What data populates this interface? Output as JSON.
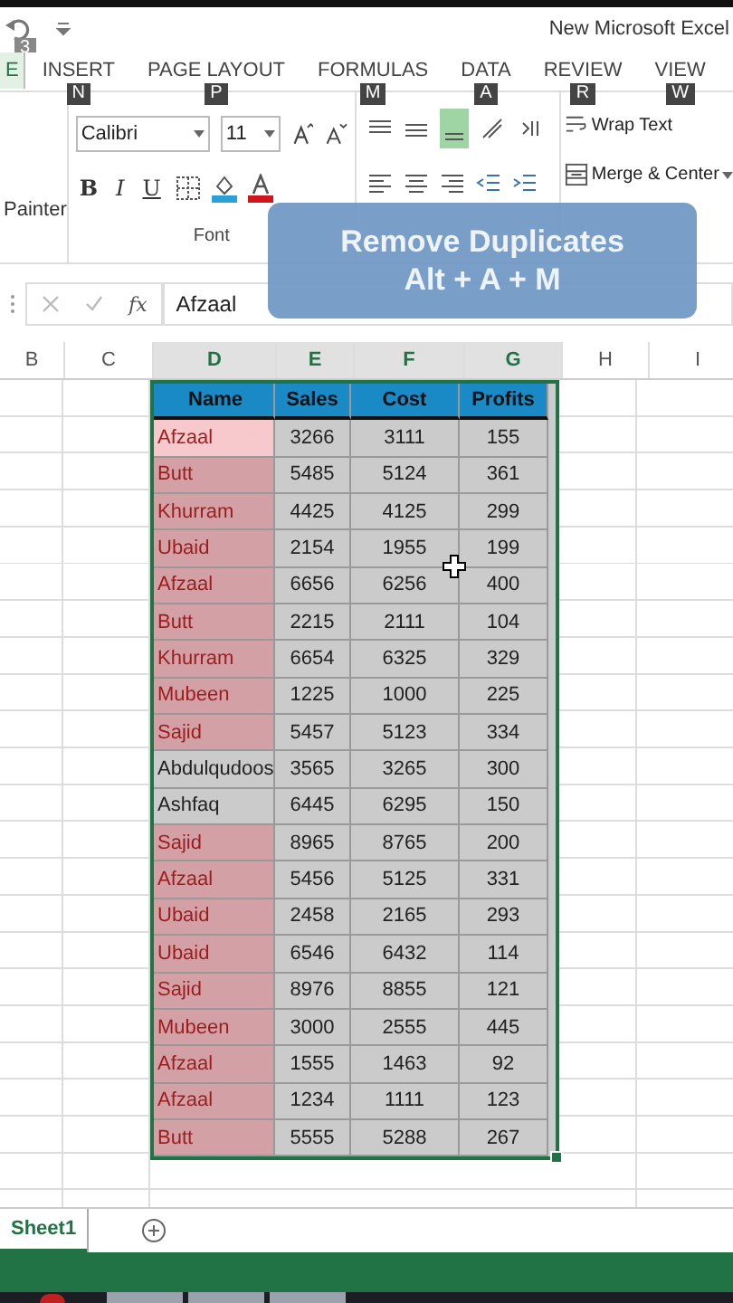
{
  "title_bar": {
    "quick_access_keytip": "3",
    "title": "New Microsoft Excel"
  },
  "tabs": [
    {
      "label": "E",
      "selected": true
    },
    {
      "label": "INSERT",
      "selected": false,
      "keytip": "N"
    },
    {
      "label": "PAGE LAYOUT",
      "selected": false,
      "keytip": "P"
    },
    {
      "label": "FORMULAS",
      "selected": false,
      "keytip": "M"
    },
    {
      "label": "DATA",
      "selected": false,
      "keytip": "A"
    },
    {
      "label": "REVIEW",
      "selected": false,
      "keytip": "R"
    },
    {
      "label": "VIEW",
      "selected": false,
      "keytip": "W"
    }
  ],
  "ribbon": {
    "painter_label": "Painter",
    "font_name": "Calibri",
    "font_size": "11",
    "bold": "B",
    "italic": "I",
    "underline": "U",
    "font_group_label": "Font",
    "wrap_text": "Wrap Text",
    "merge_center": "Merge & Center"
  },
  "overlay": {
    "title": "Remove Duplicates",
    "shortcut": "Alt + A + M"
  },
  "formula_bar": {
    "function_label": "fx",
    "value": "Afzaal"
  },
  "column_headers": [
    {
      "label": "B",
      "selected": false
    },
    {
      "label": "C",
      "selected": false
    },
    {
      "label": "D",
      "selected": true
    },
    {
      "label": "E",
      "selected": true
    },
    {
      "label": "F",
      "selected": true
    },
    {
      "label": "G",
      "selected": true
    },
    {
      "label": "H",
      "selected": false
    },
    {
      "label": "I",
      "selected": false
    }
  ],
  "table": {
    "columns": [
      "Name",
      "Sales",
      "Cost",
      "Profits"
    ],
    "rows": [
      {
        "name": "Afzaal",
        "sales": "3266",
        "cost": "3111",
        "profits": "155",
        "duplicate": true,
        "active": true
      },
      {
        "name": "Butt",
        "sales": "5485",
        "cost": "5124",
        "profits": "361",
        "duplicate": true,
        "active": false
      },
      {
        "name": "Khurram",
        "sales": "4425",
        "cost": "4125",
        "profits": "299",
        "duplicate": true,
        "active": false
      },
      {
        "name": "Ubaid",
        "sales": "2154",
        "cost": "1955",
        "profits": "199",
        "duplicate": true,
        "active": false
      },
      {
        "name": "Afzaal",
        "sales": "6656",
        "cost": "6256",
        "profits": "400",
        "duplicate": true,
        "active": false
      },
      {
        "name": "Butt",
        "sales": "2215",
        "cost": "2111",
        "profits": "104",
        "duplicate": true,
        "active": false
      },
      {
        "name": "Khurram",
        "sales": "6654",
        "cost": "6325",
        "profits": "329",
        "duplicate": true,
        "active": false
      },
      {
        "name": "Mubeen",
        "sales": "1225",
        "cost": "1000",
        "profits": "225",
        "duplicate": true,
        "active": false
      },
      {
        "name": "Sajid",
        "sales": "5457",
        "cost": "5123",
        "profits": "334",
        "duplicate": true,
        "active": false
      },
      {
        "name": "Abdulqudoos",
        "sales": "3565",
        "cost": "3265",
        "profits": "300",
        "duplicate": false,
        "active": false
      },
      {
        "name": "Ashfaq",
        "sales": "6445",
        "cost": "6295",
        "profits": "150",
        "duplicate": false,
        "active": false
      },
      {
        "name": "Sajid",
        "sales": "8965",
        "cost": "8765",
        "profits": "200",
        "duplicate": true,
        "active": false
      },
      {
        "name": "Afzaal",
        "sales": "5456",
        "cost": "5125",
        "profits": "331",
        "duplicate": true,
        "active": false
      },
      {
        "name": "Ubaid",
        "sales": "2458",
        "cost": "2165",
        "profits": "293",
        "duplicate": true,
        "active": false
      },
      {
        "name": "Ubaid",
        "sales": "6546",
        "cost": "6432",
        "profits": "114",
        "duplicate": true,
        "active": false
      },
      {
        "name": "Sajid",
        "sales": "8976",
        "cost": "8855",
        "profits": "121",
        "duplicate": true,
        "active": false
      },
      {
        "name": "Mubeen",
        "sales": "3000",
        "cost": "2555",
        "profits": "445",
        "duplicate": true,
        "active": false
      },
      {
        "name": "Afzaal",
        "sales": "1555",
        "cost": "1463",
        "profits": "92",
        "duplicate": true,
        "active": false
      },
      {
        "name": "Afzaal",
        "sales": "1234",
        "cost": "1111",
        "profits": "123",
        "duplicate": true,
        "active": false
      },
      {
        "name": "Butt",
        "sales": "5555",
        "cost": "5288",
        "profits": "267",
        "duplicate": true,
        "active": false
      }
    ]
  },
  "sheet_tabs": [
    {
      "label": "Sheet1",
      "selected": true
    }
  ]
}
